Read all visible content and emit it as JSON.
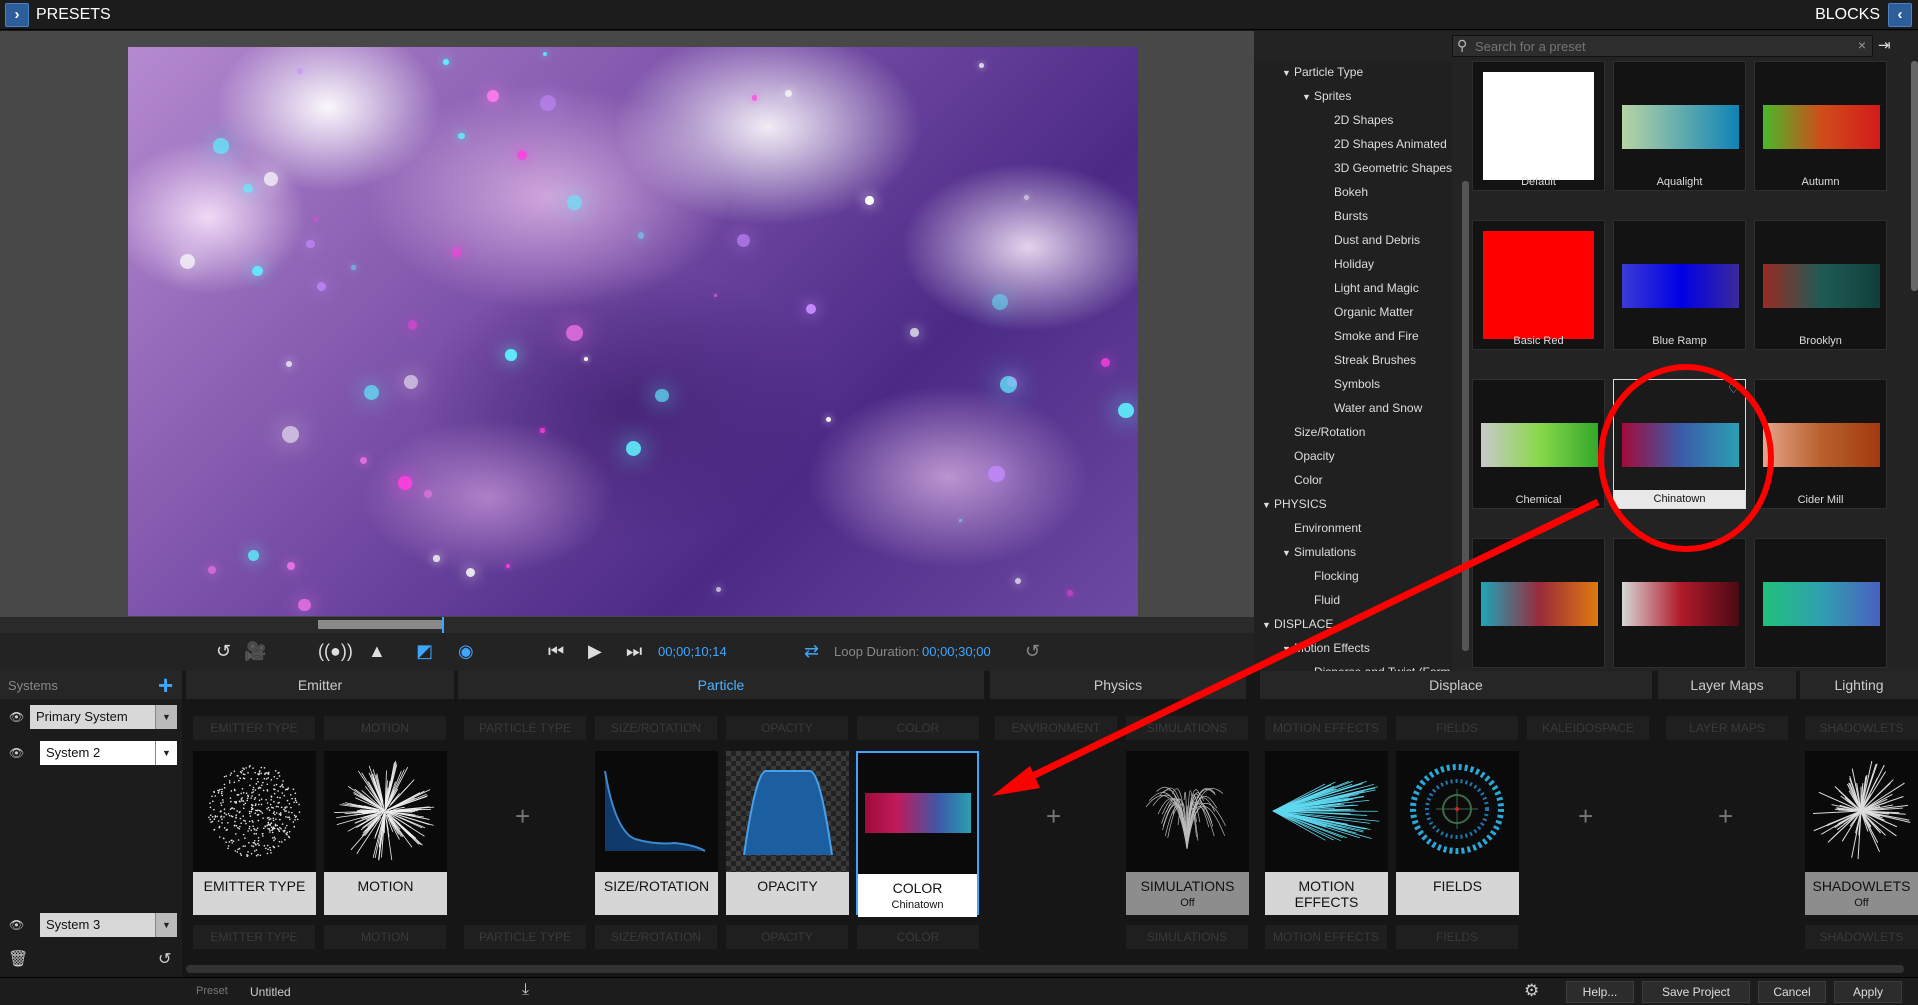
{
  "topbar": {
    "left_title": "PRESETS",
    "right_title": "BLOCKS"
  },
  "transport": {
    "timecode": "00;00;10;14",
    "loop_label": "Loop Duration:",
    "loop_value": "00;00;30;00"
  },
  "search": {
    "placeholder": "Search for a preset"
  },
  "tree": [
    {
      "label": "Particle Type",
      "indent": 1,
      "arrow": true
    },
    {
      "label": "Sprites",
      "indent": 2,
      "arrow": true
    },
    {
      "label": "2D Shapes",
      "indent": 3,
      "arrow": false
    },
    {
      "label": "2D Shapes Animated",
      "indent": 3,
      "arrow": false
    },
    {
      "label": "3D Geometric Shapes",
      "indent": 3,
      "arrow": false
    },
    {
      "label": "Bokeh",
      "indent": 3,
      "arrow": false
    },
    {
      "label": "Bursts",
      "indent": 3,
      "arrow": false
    },
    {
      "label": "Dust and Debris",
      "indent": 3,
      "arrow": false
    },
    {
      "label": "Holiday",
      "indent": 3,
      "arrow": false
    },
    {
      "label": "Light and Magic",
      "indent": 3,
      "arrow": false
    },
    {
      "label": "Organic Matter",
      "indent": 3,
      "arrow": false
    },
    {
      "label": "Smoke and Fire",
      "indent": 3,
      "arrow": false
    },
    {
      "label": "Streak Brushes",
      "indent": 3,
      "arrow": false
    },
    {
      "label": "Symbols",
      "indent": 3,
      "arrow": false
    },
    {
      "label": "Water and Snow",
      "indent": 3,
      "arrow": false
    },
    {
      "label": "Size/Rotation",
      "indent": 1,
      "arrow": false
    },
    {
      "label": "Opacity",
      "indent": 1,
      "arrow": false
    },
    {
      "label": "Color",
      "indent": 1,
      "arrow": false
    },
    {
      "label": "PHYSICS",
      "indent": 0,
      "arrow": true
    },
    {
      "label": "Environment",
      "indent": 1,
      "arrow": false
    },
    {
      "label": "Simulations",
      "indent": 1,
      "arrow": true
    },
    {
      "label": "Flocking",
      "indent": 2,
      "arrow": false
    },
    {
      "label": "Fluid",
      "indent": 2,
      "arrow": false
    },
    {
      "label": "DISPLACE",
      "indent": 0,
      "arrow": true
    },
    {
      "label": "Motion Effects",
      "indent": 1,
      "arrow": true
    },
    {
      "label": "Disperse and Twist (Form C",
      "indent": 2,
      "arrow": false
    }
  ],
  "presets": [
    {
      "label": "Default",
      "colors": [
        "#ffffff",
        "#ffffff"
      ],
      "square": true
    },
    {
      "label": "Aqualight",
      "colors": [
        "#b7d4a5",
        "#0f83b5"
      ],
      "square": false
    },
    {
      "label": "Autumn",
      "colors": [
        "#4ab82a",
        "#cf4d1a",
        "#d41a1a"
      ],
      "square": false
    },
    {
      "label": "Basic Red",
      "colors": [
        "#ff0000",
        "#ff0000"
      ],
      "square": true
    },
    {
      "label": "Blue Ramp",
      "colors": [
        "#3b3bd3",
        "#0000e6",
        "#3a2a9a"
      ],
      "square": false
    },
    {
      "label": "Brooklyn",
      "colors": [
        "#9a2b24",
        "#1f5b55",
        "#113f3a"
      ],
      "square": false
    },
    {
      "label": "Chemical",
      "colors": [
        "#c9c9c9",
        "#88d84a",
        "#34a82a"
      ],
      "square": false
    },
    {
      "label": "Chinatown",
      "colors": [
        "#a10b3c",
        "#3c5aa8",
        "#2aa0b2"
      ],
      "square": false
    },
    {
      "label": "Cider Mill",
      "colors": [
        "#e6a48a",
        "#b8602c",
        "#a33a10"
      ],
      "square": false
    },
    {
      "label": "",
      "colors": [
        "#1ea5b8",
        "#9a2a3a",
        "#e07a10"
      ],
      "square": false
    },
    {
      "label": "",
      "colors": [
        "#d6d6d6",
        "#b01a2a",
        "#4a0a12"
      ],
      "square": false
    },
    {
      "label": "",
      "colors": [
        "#20c07a",
        "#30a0b0",
        "#4a60c0"
      ],
      "square": false
    }
  ],
  "systems": {
    "label": "Systems",
    "items": [
      "Primary System",
      "System 2",
      "System 3"
    ]
  },
  "sections": [
    {
      "label": "Emitter",
      "active": false
    },
    {
      "label": "Particle",
      "active": true
    },
    {
      "label": "Physics",
      "active": false
    },
    {
      "label": "Displace",
      "active": false
    },
    {
      "label": "Layer Maps",
      "active": false
    },
    {
      "label": "Lighting",
      "active": false
    }
  ],
  "ghosts": {
    "emitter_type": "EMITTER TYPE",
    "motion": "MOTION",
    "particle_type": "PARTICLE TYPE",
    "size_rotation": "SIZE/ROTATION",
    "opacity": "OPACITY",
    "color": "COLOR",
    "environment": "ENVIRONMENT",
    "simulations": "SIMULATIONS",
    "motion_effects": "MOTION EFFECTS",
    "fields": "FIELDS",
    "kaleidospace": "KALEIDOSPACE",
    "layer_maps": "LAYER MAPS",
    "shadowlets": "SHADOWLETS",
    "off": "Off"
  },
  "blocks": {
    "emitter_type": "EMITTER TYPE",
    "motion": "MOTION",
    "size_rotation": "SIZE/ROTATION",
    "opacity": "OPACITY",
    "color": "COLOR",
    "color_sub": "Chinatown",
    "simulations": "SIMULATIONS",
    "simulations_sub": "Off",
    "motion_effects": "MOTION EFFECTS",
    "fields": "FIELDS",
    "shadowlets": "SHADOWLETS",
    "shadowlets_sub": "Off"
  },
  "status": {
    "preset_label": "Preset",
    "preset_value": "Untitled",
    "help": "Help...",
    "save_project": "Save Project",
    "cancel": "Cancel",
    "apply": "Apply"
  },
  "colors": {
    "accent": "#3ea6ff",
    "annotation": "#ff0000"
  }
}
